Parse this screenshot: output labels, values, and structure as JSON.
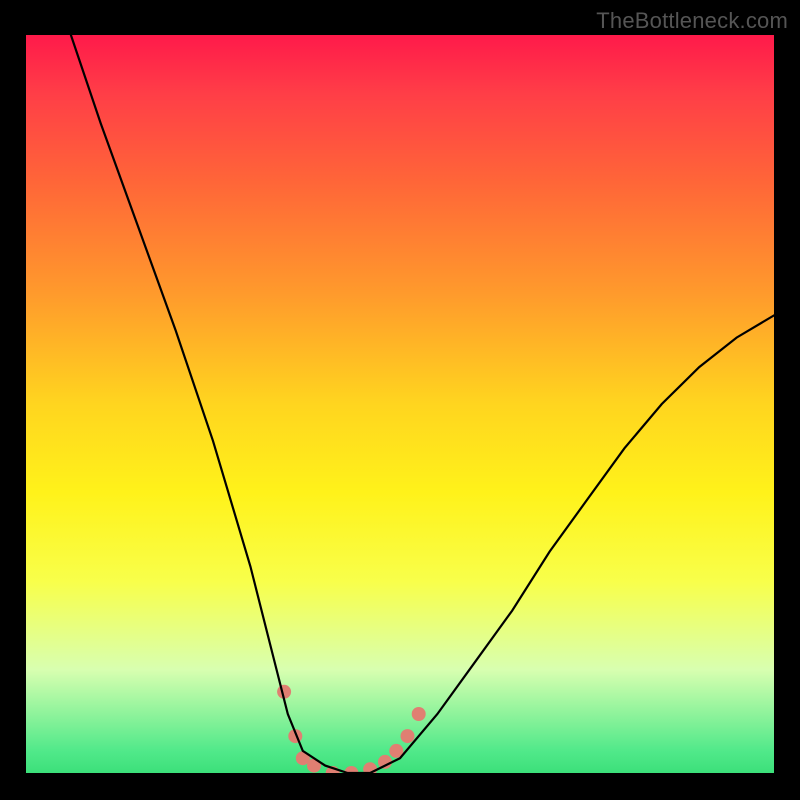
{
  "watermark": {
    "text": "TheBottleneck.com"
  },
  "chart_data": {
    "type": "line",
    "title": "",
    "xlabel": "",
    "ylabel": "",
    "xlim": [
      0,
      100
    ],
    "ylim": [
      0,
      100
    ],
    "series": [
      {
        "name": "curve",
        "color": "#000000",
        "x": [
          6,
          10,
          15,
          20,
          25,
          30,
          33,
          35,
          37,
          40,
          43,
          46,
          50,
          55,
          60,
          65,
          70,
          75,
          80,
          85,
          90,
          95,
          100
        ],
        "y": [
          100,
          88,
          74,
          60,
          45,
          28,
          16,
          8,
          3,
          1,
          0,
          0,
          2,
          8,
          15,
          22,
          30,
          37,
          44,
          50,
          55,
          59,
          62
        ]
      }
    ],
    "markers": [
      {
        "name": "trough-dot",
        "x": 34.5,
        "y": 11,
        "color": "#e07f72",
        "r": 7
      },
      {
        "name": "trough-dot",
        "x": 36.0,
        "y": 5,
        "color": "#e07f72",
        "r": 7
      },
      {
        "name": "trough-dot",
        "x": 37.0,
        "y": 2,
        "color": "#e07f72",
        "r": 7
      },
      {
        "name": "trough-dot",
        "x": 38.5,
        "y": 1,
        "color": "#e07f72",
        "r": 7
      },
      {
        "name": "trough-dot",
        "x": 41.0,
        "y": 0,
        "color": "#e07f72",
        "r": 7
      },
      {
        "name": "trough-dot",
        "x": 43.5,
        "y": 0,
        "color": "#e07f72",
        "r": 7
      },
      {
        "name": "trough-dot",
        "x": 46.0,
        "y": 0.5,
        "color": "#e07f72",
        "r": 7
      },
      {
        "name": "trough-dot",
        "x": 48.0,
        "y": 1.5,
        "color": "#e07f72",
        "r": 7
      },
      {
        "name": "trough-dot",
        "x": 49.5,
        "y": 3,
        "color": "#e07f72",
        "r": 7
      },
      {
        "name": "trough-dot",
        "x": 51.0,
        "y": 5,
        "color": "#e07f72",
        "r": 7
      },
      {
        "name": "trough-dot",
        "x": 52.5,
        "y": 8,
        "color": "#e07f72",
        "r": 7
      }
    ],
    "background_gradient": {
      "stops": [
        {
          "pct": 0,
          "color": "#ff1a4a"
        },
        {
          "pct": 50,
          "color": "#ffd51f"
        },
        {
          "pct": 75,
          "color": "#f8ff4a"
        },
        {
          "pct": 100,
          "color": "#3ce07a"
        }
      ]
    }
  }
}
